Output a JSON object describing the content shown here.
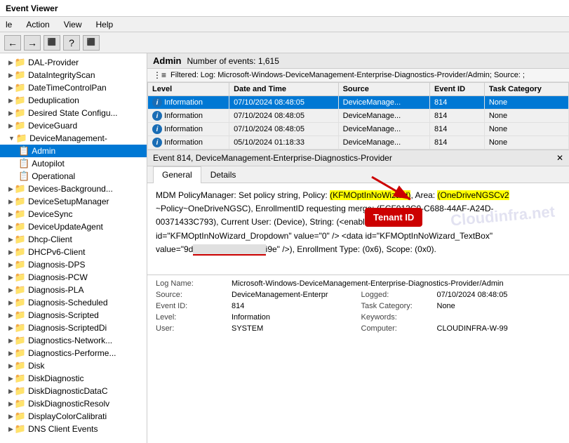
{
  "titleBar": {
    "title": "Event Viewer"
  },
  "menuBar": {
    "items": [
      "le",
      "Action",
      "View",
      "Help"
    ]
  },
  "toolbar": {
    "buttons": [
      "←",
      "→",
      "⬛",
      "?",
      "⬛"
    ]
  },
  "tree": {
    "items": [
      {
        "label": "DAL-Provider",
        "indent": 1,
        "arrow": "▶",
        "selected": false
      },
      {
        "label": "DataIntegrityScan",
        "indent": 1,
        "arrow": "▶",
        "selected": false
      },
      {
        "label": "DateTimeControlPan",
        "indent": 1,
        "arrow": "▶",
        "selected": false
      },
      {
        "label": "Deduplication",
        "indent": 1,
        "arrow": "▶",
        "selected": false
      },
      {
        "label": "Desired State Configu...",
        "indent": 1,
        "arrow": "▶",
        "selected": false
      },
      {
        "label": "DeviceGuard",
        "indent": 1,
        "arrow": "▶",
        "selected": false
      },
      {
        "label": "DeviceManagement-",
        "indent": 1,
        "arrow": "▼",
        "selected": false
      },
      {
        "label": "Admin",
        "indent": 2,
        "arrow": "",
        "selected": true,
        "icon": "📋"
      },
      {
        "label": "Autopilot",
        "indent": 2,
        "arrow": "",
        "selected": false,
        "icon": "📋"
      },
      {
        "label": "Operational",
        "indent": 2,
        "arrow": "",
        "selected": false,
        "icon": "📋"
      },
      {
        "label": "Devices-Background...",
        "indent": 1,
        "arrow": "▶",
        "selected": false
      },
      {
        "label": "DeviceSetupManager",
        "indent": 1,
        "arrow": "▶",
        "selected": false
      },
      {
        "label": "DeviceSync",
        "indent": 1,
        "arrow": "▶",
        "selected": false
      },
      {
        "label": "DeviceUpdateAgent",
        "indent": 1,
        "arrow": "▶",
        "selected": false
      },
      {
        "label": "Dhcp-Client",
        "indent": 1,
        "arrow": "▶",
        "selected": false
      },
      {
        "label": "DHCPv6-Client",
        "indent": 1,
        "arrow": "▶",
        "selected": false
      },
      {
        "label": "Diagnosis-DPS",
        "indent": 1,
        "arrow": "▶",
        "selected": false
      },
      {
        "label": "Diagnosis-PCW",
        "indent": 1,
        "arrow": "▶",
        "selected": false
      },
      {
        "label": "Diagnosis-PLA",
        "indent": 1,
        "arrow": "▶",
        "selected": false
      },
      {
        "label": "Diagnosis-Scheduled",
        "indent": 1,
        "arrow": "▶",
        "selected": false
      },
      {
        "label": "Diagnosis-Scripted",
        "indent": 1,
        "arrow": "▶",
        "selected": false
      },
      {
        "label": "Diagnosis-ScriptedDi",
        "indent": 1,
        "arrow": "▶",
        "selected": false
      },
      {
        "label": "Diagnostics-Network...",
        "indent": 1,
        "arrow": "▶",
        "selected": false
      },
      {
        "label": "Diagnostics-Performe...",
        "indent": 1,
        "arrow": "▶",
        "selected": false
      },
      {
        "label": "Disk",
        "indent": 1,
        "arrow": "▶",
        "selected": false
      },
      {
        "label": "DiskDiagnostic",
        "indent": 1,
        "arrow": "▶",
        "selected": false
      },
      {
        "label": "DiskDiagnosticDataC",
        "indent": 1,
        "arrow": "▶",
        "selected": false
      },
      {
        "label": "DiskDiagnosticResolv",
        "indent": 1,
        "arrow": "▶",
        "selected": false
      },
      {
        "label": "DisplayColorCalibrati",
        "indent": 1,
        "arrow": "▶",
        "selected": false
      },
      {
        "label": "DNS Client Events",
        "indent": 1,
        "arrow": "▶",
        "selected": false
      }
    ]
  },
  "eventList": {
    "adminLabel": "Admin",
    "eventCount": "Number of events: 1,615",
    "filterText": "Filtered: Log: Microsoft-Windows-DeviceManagement-Enterprise-Diagnostics-Provider/Admin; Source: ;",
    "columns": [
      "Level",
      "Date and Time",
      "Source",
      "Event ID",
      "Task Category"
    ],
    "rows": [
      {
        "level": "Information",
        "dateTime": "07/10/2024 08:48:05",
        "source": "DeviceManage...",
        "eventId": "814",
        "taskCategory": "None",
        "selected": true
      },
      {
        "level": "Information",
        "dateTime": "07/10/2024 08:48:05",
        "source": "DeviceManage...",
        "eventId": "814",
        "taskCategory": "None",
        "selected": false
      },
      {
        "level": "Information",
        "dateTime": "07/10/2024 08:48:05",
        "source": "DeviceManage...",
        "eventId": "814",
        "taskCategory": "None",
        "selected": false
      },
      {
        "level": "Information",
        "dateTime": "05/10/2024 01:18:33",
        "source": "DeviceManage...",
        "eventId": "814",
        "taskCategory": "None",
        "selected": false
      }
    ]
  },
  "eventDetail": {
    "headerTitle": "Event 814, DeviceManagement-Enterprise-Diagnostics-Provider",
    "tabs": [
      "General",
      "Details"
    ],
    "activeTab": "General",
    "contentParts": [
      {
        "type": "text",
        "text": "MDM PolicyManager: Set policy string, Policy: "
      },
      {
        "type": "highlight-yellow",
        "text": "(KFMOptInNoWizard)"
      },
      {
        "type": "text",
        "text": ", Area: "
      },
      {
        "type": "highlight-yellow",
        "text": "(OneDriveNGSCv2"
      },
      {
        "type": "text",
        "text": "\n~Policy~OneDriveNGSC), EnrollmentID requesting merge: (ECF013C0-C688-44AF-A24D-\n00371433C793), Current User: (Device), String: (<enabled/> <data\nid=\"KFMOptInNoWizard_Dropdown\" value=\"0\" /> <data id=\"KFMOptInNoWizard_TextBox\"\nvalue=\"9d"
      },
      {
        "type": "redacted",
        "text": "                                         i9e"
      },
      {
        "type": "text",
        "text": " />), Enrollment Type: (0x6), Scope: (0x0)."
      }
    ],
    "arrowAnnotation": {
      "label": "Tenant ID"
    },
    "watermark": "Cloudinfra.net"
  },
  "bottomInfo": {
    "rows": [
      {
        "logNameLabel": "Log Name:",
        "logNameValue": "Microsoft-Windows-DeviceManagement-Enterprise-Diagnostics-Provider/Admin",
        "sourceLabel": "",
        "sourceValue": ""
      },
      {
        "logNameLabel": "Source:",
        "logNameValue": "DeviceManagement-Enterpr",
        "sourceLabel": "Logged:",
        "sourceValue": "07/10/2024 08:48:05"
      },
      {
        "logNameLabel": "Event ID:",
        "logNameValue": "814",
        "sourceLabel": "Task Category:",
        "sourceValue": "None"
      },
      {
        "logNameLabel": "Level:",
        "logNameValue": "Information",
        "sourceLabel": "Keywords:",
        "sourceValue": ""
      },
      {
        "logNameLabel": "User:",
        "logNameValue": "SYSTEM",
        "sourceLabel": "Computer:",
        "sourceValue": "CLOUDINFRA-W-99"
      }
    ]
  }
}
